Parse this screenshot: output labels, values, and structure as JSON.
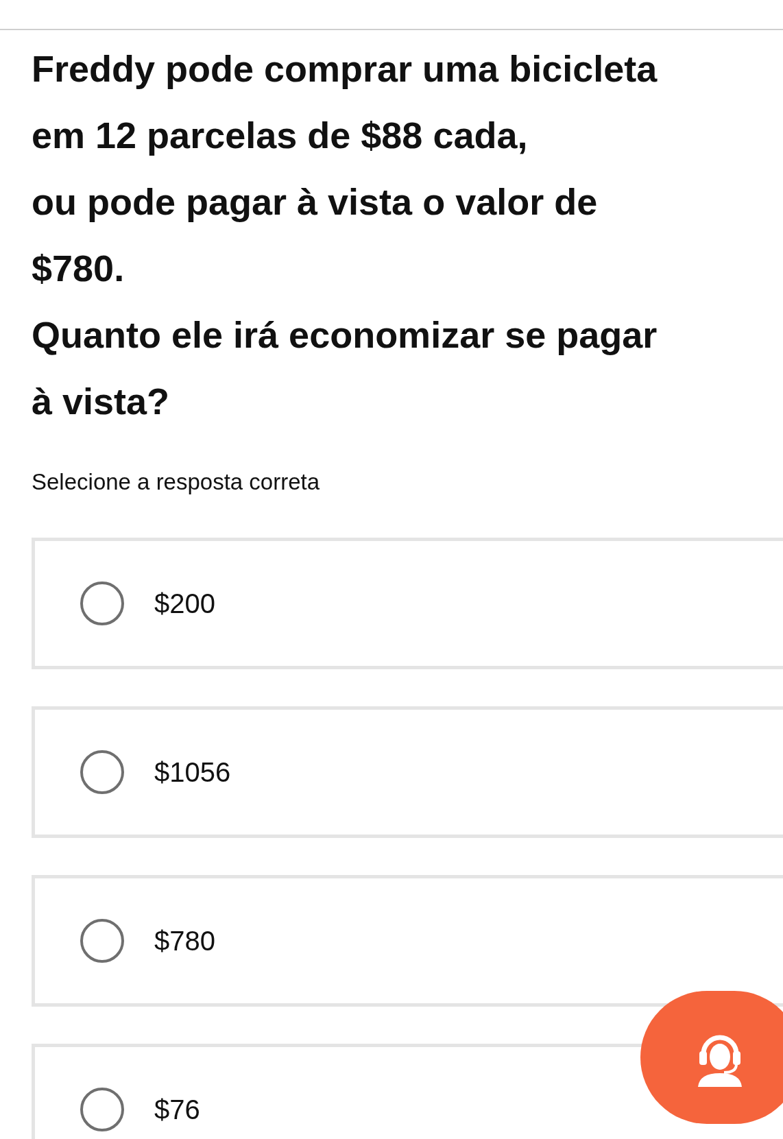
{
  "question_lines": [
    "Freddy pode comprar uma bicicleta",
    "em 12 parcelas de $88 cada,",
    "ou pode pagar à vista o valor de",
    "$780.",
    "Quanto ele irá economizar se pagar",
    "à vista?"
  ],
  "instruction": "Selecione a resposta correta",
  "options": [
    {
      "label": "$200",
      "selected": false
    },
    {
      "label": "$1056",
      "selected": false
    },
    {
      "label": "$780",
      "selected": false
    },
    {
      "label": "$76",
      "selected": false
    }
  ],
  "support_button": {
    "kind": "support"
  }
}
